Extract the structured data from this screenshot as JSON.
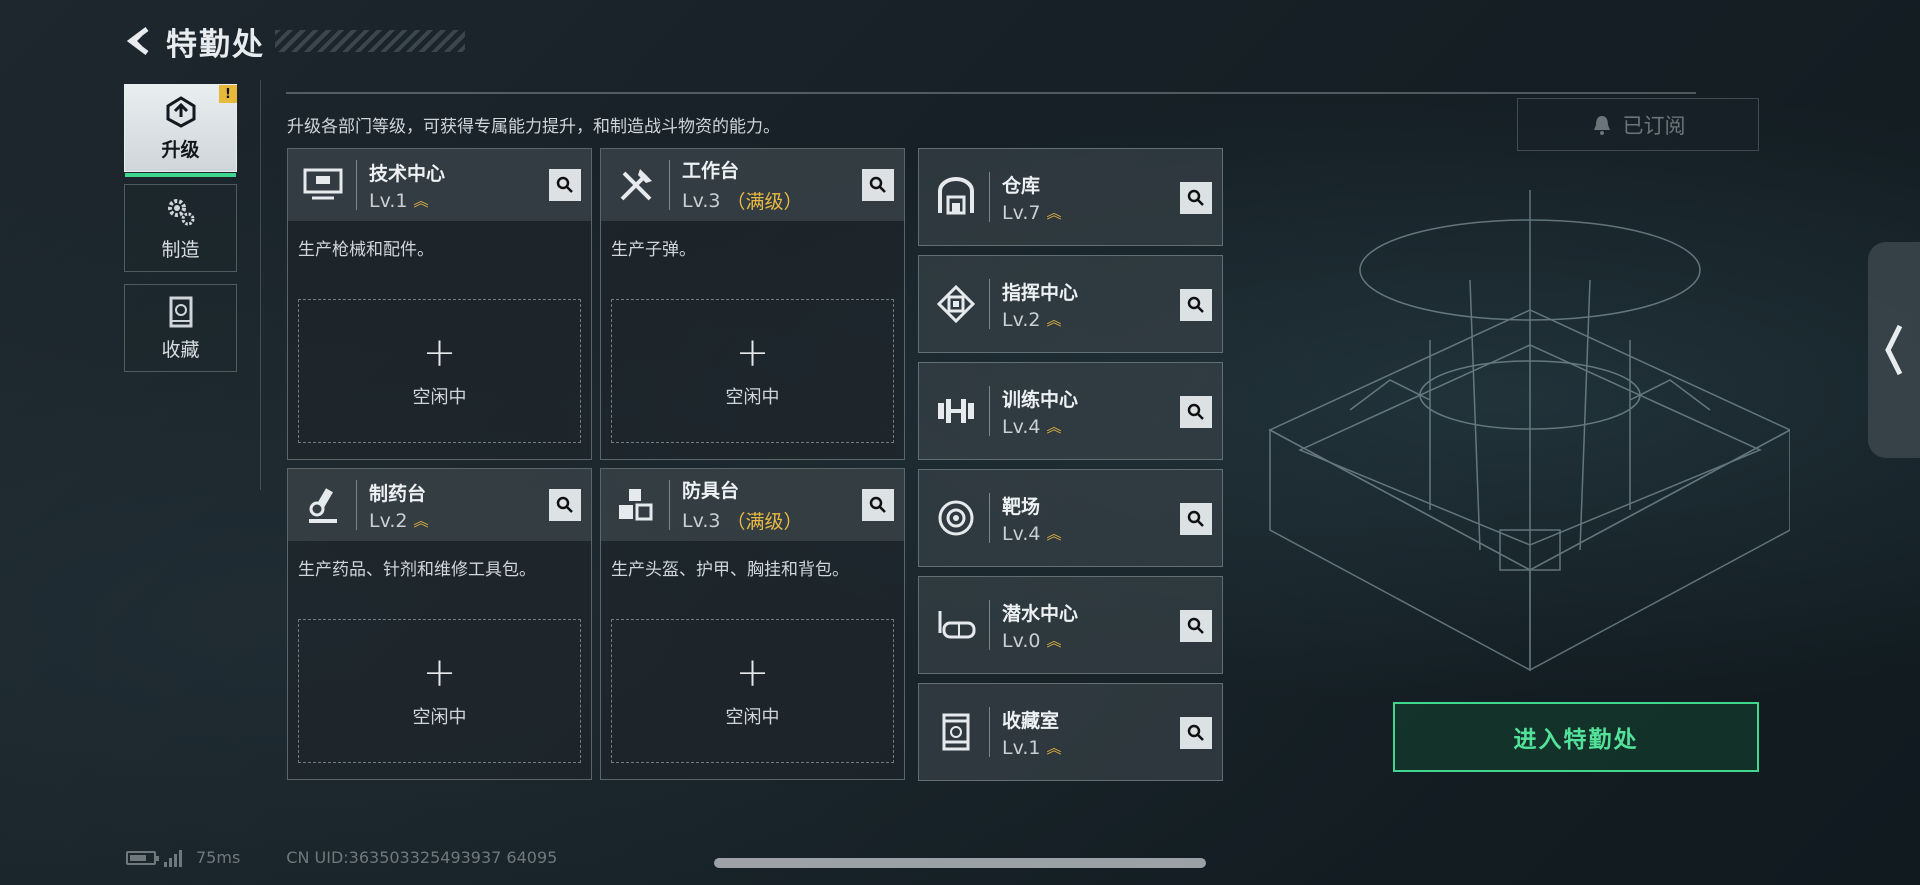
{
  "header": {
    "title": "特勤处"
  },
  "sidebar": {
    "items": [
      {
        "label": "升级",
        "icon": "upgrade-icon",
        "active": true,
        "badge": "!"
      },
      {
        "label": "制造",
        "icon": "gears-icon",
        "active": false
      },
      {
        "label": "收藏",
        "icon": "collection-icon",
        "active": false
      }
    ]
  },
  "instruction": "升级各部门等级，可获得专属能力提升，和制造战斗物资的能力。",
  "subscribe_button": {
    "label": "已订阅"
  },
  "workshops": [
    {
      "name": "技术中心",
      "level": "Lv.1",
      "max_label": "",
      "desc": "生产枪械和配件。",
      "slot_label": "空闲中",
      "icon": "monitor-icon"
    },
    {
      "name": "工作台",
      "level": "Lv.3",
      "max_label": "（满级）",
      "desc": "生产子弹。",
      "slot_label": "空闲中",
      "icon": "tools-icon"
    },
    {
      "name": "制药台",
      "level": "Lv.2",
      "max_label": "",
      "desc": "生产药品、针剂和维修工具包。",
      "slot_label": "空闲中",
      "icon": "microscope-icon"
    },
    {
      "name": "防具台",
      "level": "Lv.3",
      "max_label": "（满级）",
      "desc": "生产头盔、护甲、胸挂和背包。",
      "slot_label": "空闲中",
      "icon": "boxes-icon"
    }
  ],
  "facilities": [
    {
      "name": "仓库",
      "level": "Lv.7",
      "icon": "warehouse-icon"
    },
    {
      "name": "指挥中心",
      "level": "Lv.2",
      "icon": "chip-icon"
    },
    {
      "name": "训练中心",
      "level": "Lv.4",
      "icon": "dumbbell-icon"
    },
    {
      "name": "靶场",
      "level": "Lv.4",
      "icon": "target-icon"
    },
    {
      "name": "潜水中心",
      "level": "Lv.0",
      "icon": "diving-mask-icon"
    },
    {
      "name": "收藏室",
      "level": "Lv.1",
      "icon": "vault-icon"
    }
  ],
  "enter_button": {
    "label": "进入特勤处"
  },
  "status": {
    "ping": "75ms",
    "uid": "CN UID:363503325493937 64095"
  },
  "colors": {
    "accent_green": "#3fd68e",
    "level_gold": "#e9b943"
  }
}
